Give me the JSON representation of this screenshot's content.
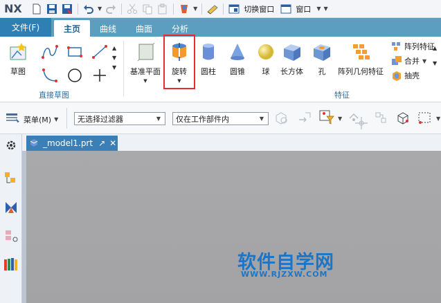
{
  "app": {
    "logo": "NX"
  },
  "quick_access": {
    "switch_window_label": "切换窗口",
    "window_label": "窗口"
  },
  "tabs": [
    {
      "label": "文件(F)"
    },
    {
      "label": "主页"
    },
    {
      "label": "曲线"
    },
    {
      "label": "曲面"
    },
    {
      "label": "分析"
    }
  ],
  "ribbon": {
    "sketch_label": "草图",
    "direct_sketch_group": "直接草图",
    "feature_group": "特征",
    "buttons": [
      {
        "label": "基准平面"
      },
      {
        "label": "旋转"
      },
      {
        "label": "圆柱"
      },
      {
        "label": "圆锥"
      },
      {
        "label": "球"
      },
      {
        "label": "长方体"
      },
      {
        "label": "孔"
      },
      {
        "label": "阵列几何特征"
      }
    ],
    "small_buttons": [
      {
        "label": "阵列特征"
      },
      {
        "label": "合并"
      },
      {
        "label": "抽壳"
      }
    ]
  },
  "selection_bar": {
    "menu_label": "菜单(M)",
    "filter_value": "无选择过滤器",
    "scope_value": "仅在工作部件内"
  },
  "document": {
    "tab_name": "_model1.prt"
  },
  "watermark": {
    "title": "软件自学网",
    "url": "WWW.RJZXW.COM"
  },
  "colors": {
    "accent": "#2f7fb5",
    "highlight_box": "#e52b2b",
    "watermark": "#1c75c6"
  }
}
